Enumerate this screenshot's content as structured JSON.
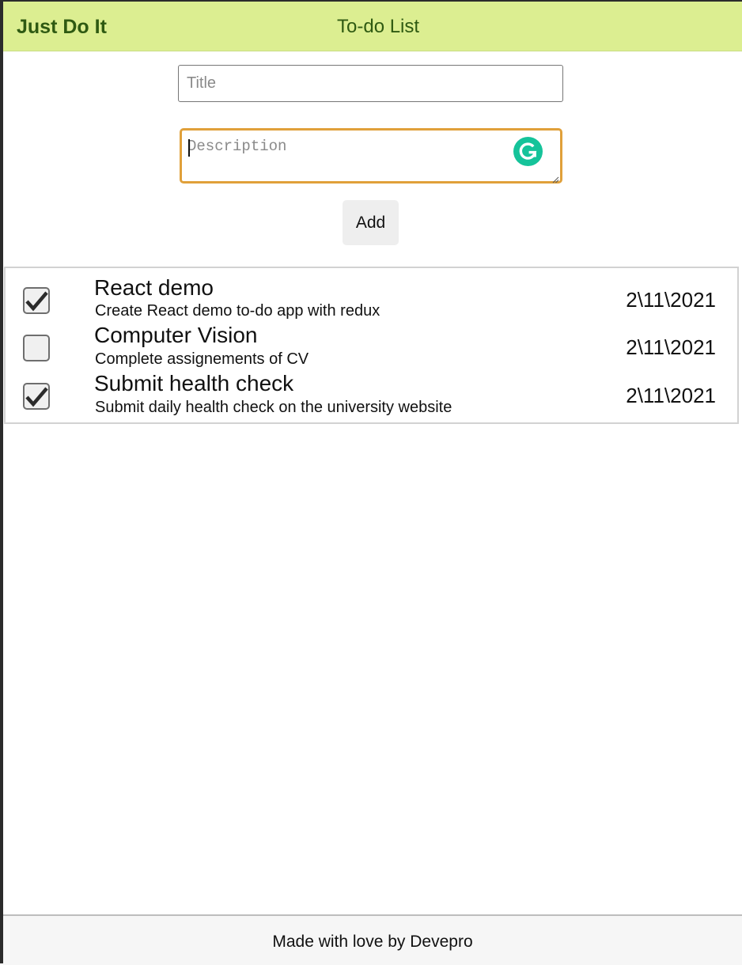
{
  "navbar": {
    "brand": "Just Do It",
    "title": "To-do List"
  },
  "form": {
    "title_placeholder": "Title",
    "title_value": "",
    "description_placeholder": "Description",
    "description_value": "",
    "add_label": "Add"
  },
  "todos": [
    {
      "title": "React demo",
      "description": "Create React demo to-do app with redux",
      "date": "2\\11\\2021",
      "completed": true
    },
    {
      "title": "Computer Vision",
      "description": "Complete assignements of CV",
      "date": "2\\11\\2021",
      "completed": false
    },
    {
      "title": "Submit health check",
      "description": "Submit daily health check on the university website",
      "date": "2\\11\\2021",
      "completed": true
    }
  ],
  "footer": {
    "text": "Made with love by Devepro"
  },
  "colors": {
    "navbar_bg": "#dcee91",
    "brand_text": "#2f5a12",
    "focus_border": "#e0a03a",
    "grammarly": "#15c39a",
    "checkmark": "#2b2b2b"
  },
  "icons": {
    "grammarly": "grammarly-g-icon",
    "check": "checkmark-icon"
  }
}
